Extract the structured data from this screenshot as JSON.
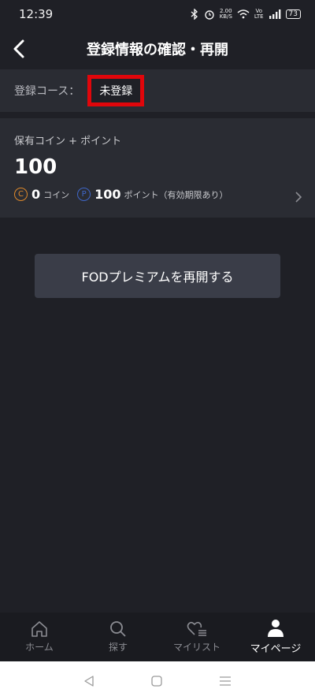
{
  "status_bar": {
    "time": "12:39",
    "net_speed_top": "2.00",
    "net_speed_bottom": "KB/S",
    "volte_top": "Vo",
    "volte_bottom": "LTE",
    "battery": "73"
  },
  "header": {
    "title": "登録情報の確認・再開",
    "back_icon": "chevron-left-icon"
  },
  "course": {
    "label": "登録コース：",
    "value": "未登録",
    "highlight_color": "#e0060b"
  },
  "points": {
    "title": "保有コイン + ポイント",
    "total": "100",
    "coin_symbol": "C",
    "coin_count": "0",
    "coin_label": "コイン",
    "point_symbol": "P",
    "point_count": "100",
    "point_label": "ポイント（有効期限あり）"
  },
  "resume_button": {
    "label": "FODプレミアムを再開する"
  },
  "tabbar": {
    "tabs": [
      {
        "label": "ホーム",
        "icon": "home-icon"
      },
      {
        "label": "探す",
        "icon": "search-icon"
      },
      {
        "label": "マイリスト",
        "icon": "heart-list-icon"
      },
      {
        "label": "マイページ",
        "icon": "person-icon",
        "active": true
      }
    ]
  },
  "system_nav": {
    "icons": [
      "back-triangle-icon",
      "home-square-icon",
      "recents-menu-icon"
    ]
  }
}
